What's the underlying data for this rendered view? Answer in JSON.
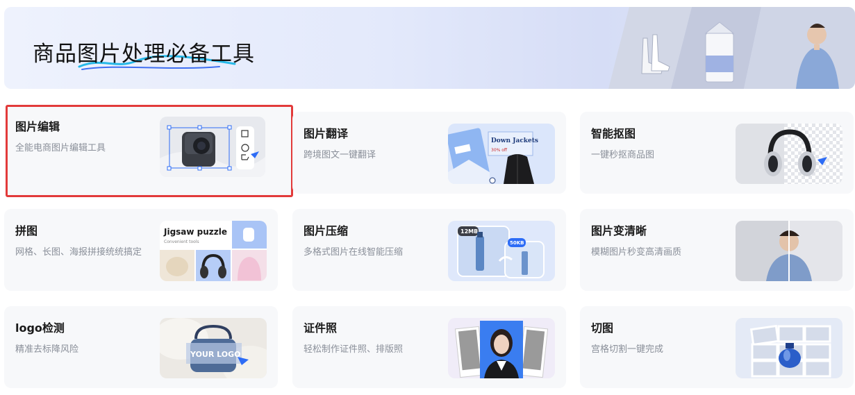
{
  "banner": {
    "title": "商品图片处理必备工具",
    "logo_text": "YOUR LOGO"
  },
  "tools": [
    {
      "title": "图片编辑",
      "desc": "全能电商图片编辑工具",
      "selected": true
    },
    {
      "title": "图片翻译",
      "desc": "跨境图文一键翻译",
      "thumb_text": "Down Jackets",
      "thumb_price": "30% off"
    },
    {
      "title": "智能抠图",
      "desc": "一键秒抠商品图"
    },
    {
      "title": "拼图",
      "desc": "网格、长图、海报拼接统统搞定",
      "thumb_text": "Jigsaw puzzle",
      "thumb_sub": "Convenient tools"
    },
    {
      "title": "图片压缩",
      "desc": "多格式图片在线智能压缩",
      "size_before": "12MB",
      "size_after": "50KB"
    },
    {
      "title": "图片变清晰",
      "desc": "模糊图片秒变高清画质"
    },
    {
      "title": "logo检测",
      "desc": "精准去标降风险",
      "thumb_text": "YOUR LOGO"
    },
    {
      "title": "证件照",
      "desc": "轻松制作证件照、排版照"
    },
    {
      "title": "切图",
      "desc": "宫格切割一键完成"
    }
  ],
  "colors": {
    "accent": "#2d6cf6",
    "selected_border": "#e23a3a"
  }
}
